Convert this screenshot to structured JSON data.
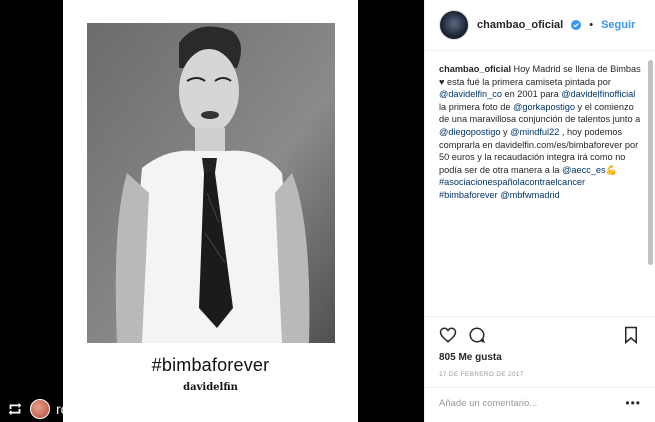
{
  "post": {
    "hashtag_overlay": "#bimbaforever",
    "brand_mark": "davidelfin"
  },
  "repost": {
    "username": "rossydpalma"
  },
  "header": {
    "username": "chambao_oficial",
    "separator": "•",
    "follow_label": "Seguir"
  },
  "caption": {
    "username": "chambao_oficial",
    "parts": [
      {
        "t": "text",
        "v": " Hoy Madrid se llena de Bimbas "
      },
      {
        "t": "text",
        "v": "♥"
      },
      {
        "t": "text",
        "v": " esta fué la primera camiseta pintada por "
      },
      {
        "t": "link",
        "v": "@davidelfin_co"
      },
      {
        "t": "text",
        "v": " en 2001 para "
      },
      {
        "t": "link",
        "v": "@davidelfinofficial"
      },
      {
        "t": "text",
        "v": " la primera foto de "
      },
      {
        "t": "link",
        "v": "@gorkapostigo"
      },
      {
        "t": "text",
        "v": " y el comienzo de una maravillosa conjunción de talentos junto a "
      },
      {
        "t": "link",
        "v": "@diegopostigo"
      },
      {
        "t": "text",
        "v": " y "
      },
      {
        "t": "link",
        "v": "@mindful22"
      },
      {
        "t": "text",
        "v": " , hoy podemos comprarla en davidelfin.com/es/bimbaforever por 50 euros y la recaudación integra irá como no podía ser de otra manera a la "
      },
      {
        "t": "link",
        "v": "@aecc_es"
      },
      {
        "t": "text",
        "v": "💪 "
      },
      {
        "t": "link",
        "v": "#asociacionespañolacontraelcancer"
      },
      {
        "t": "text",
        "v": " "
      },
      {
        "t": "link",
        "v": "#bimbaforever"
      },
      {
        "t": "text",
        "v": " "
      },
      {
        "t": "link",
        "v": "@mbfwmadrid"
      }
    ]
  },
  "actions": {
    "like_icon": "heart-icon",
    "comment_icon": "comment-icon",
    "save_icon": "bookmark-icon"
  },
  "likes": "805 Me gusta",
  "date": "17 DE FEBRERO DE 2017",
  "comment_placeholder": "Añade un comentario...",
  "more_label": "•••",
  "colors": {
    "link": "#003569",
    "follow": "#3897f0",
    "text": "#262626",
    "muted": "#999999"
  }
}
